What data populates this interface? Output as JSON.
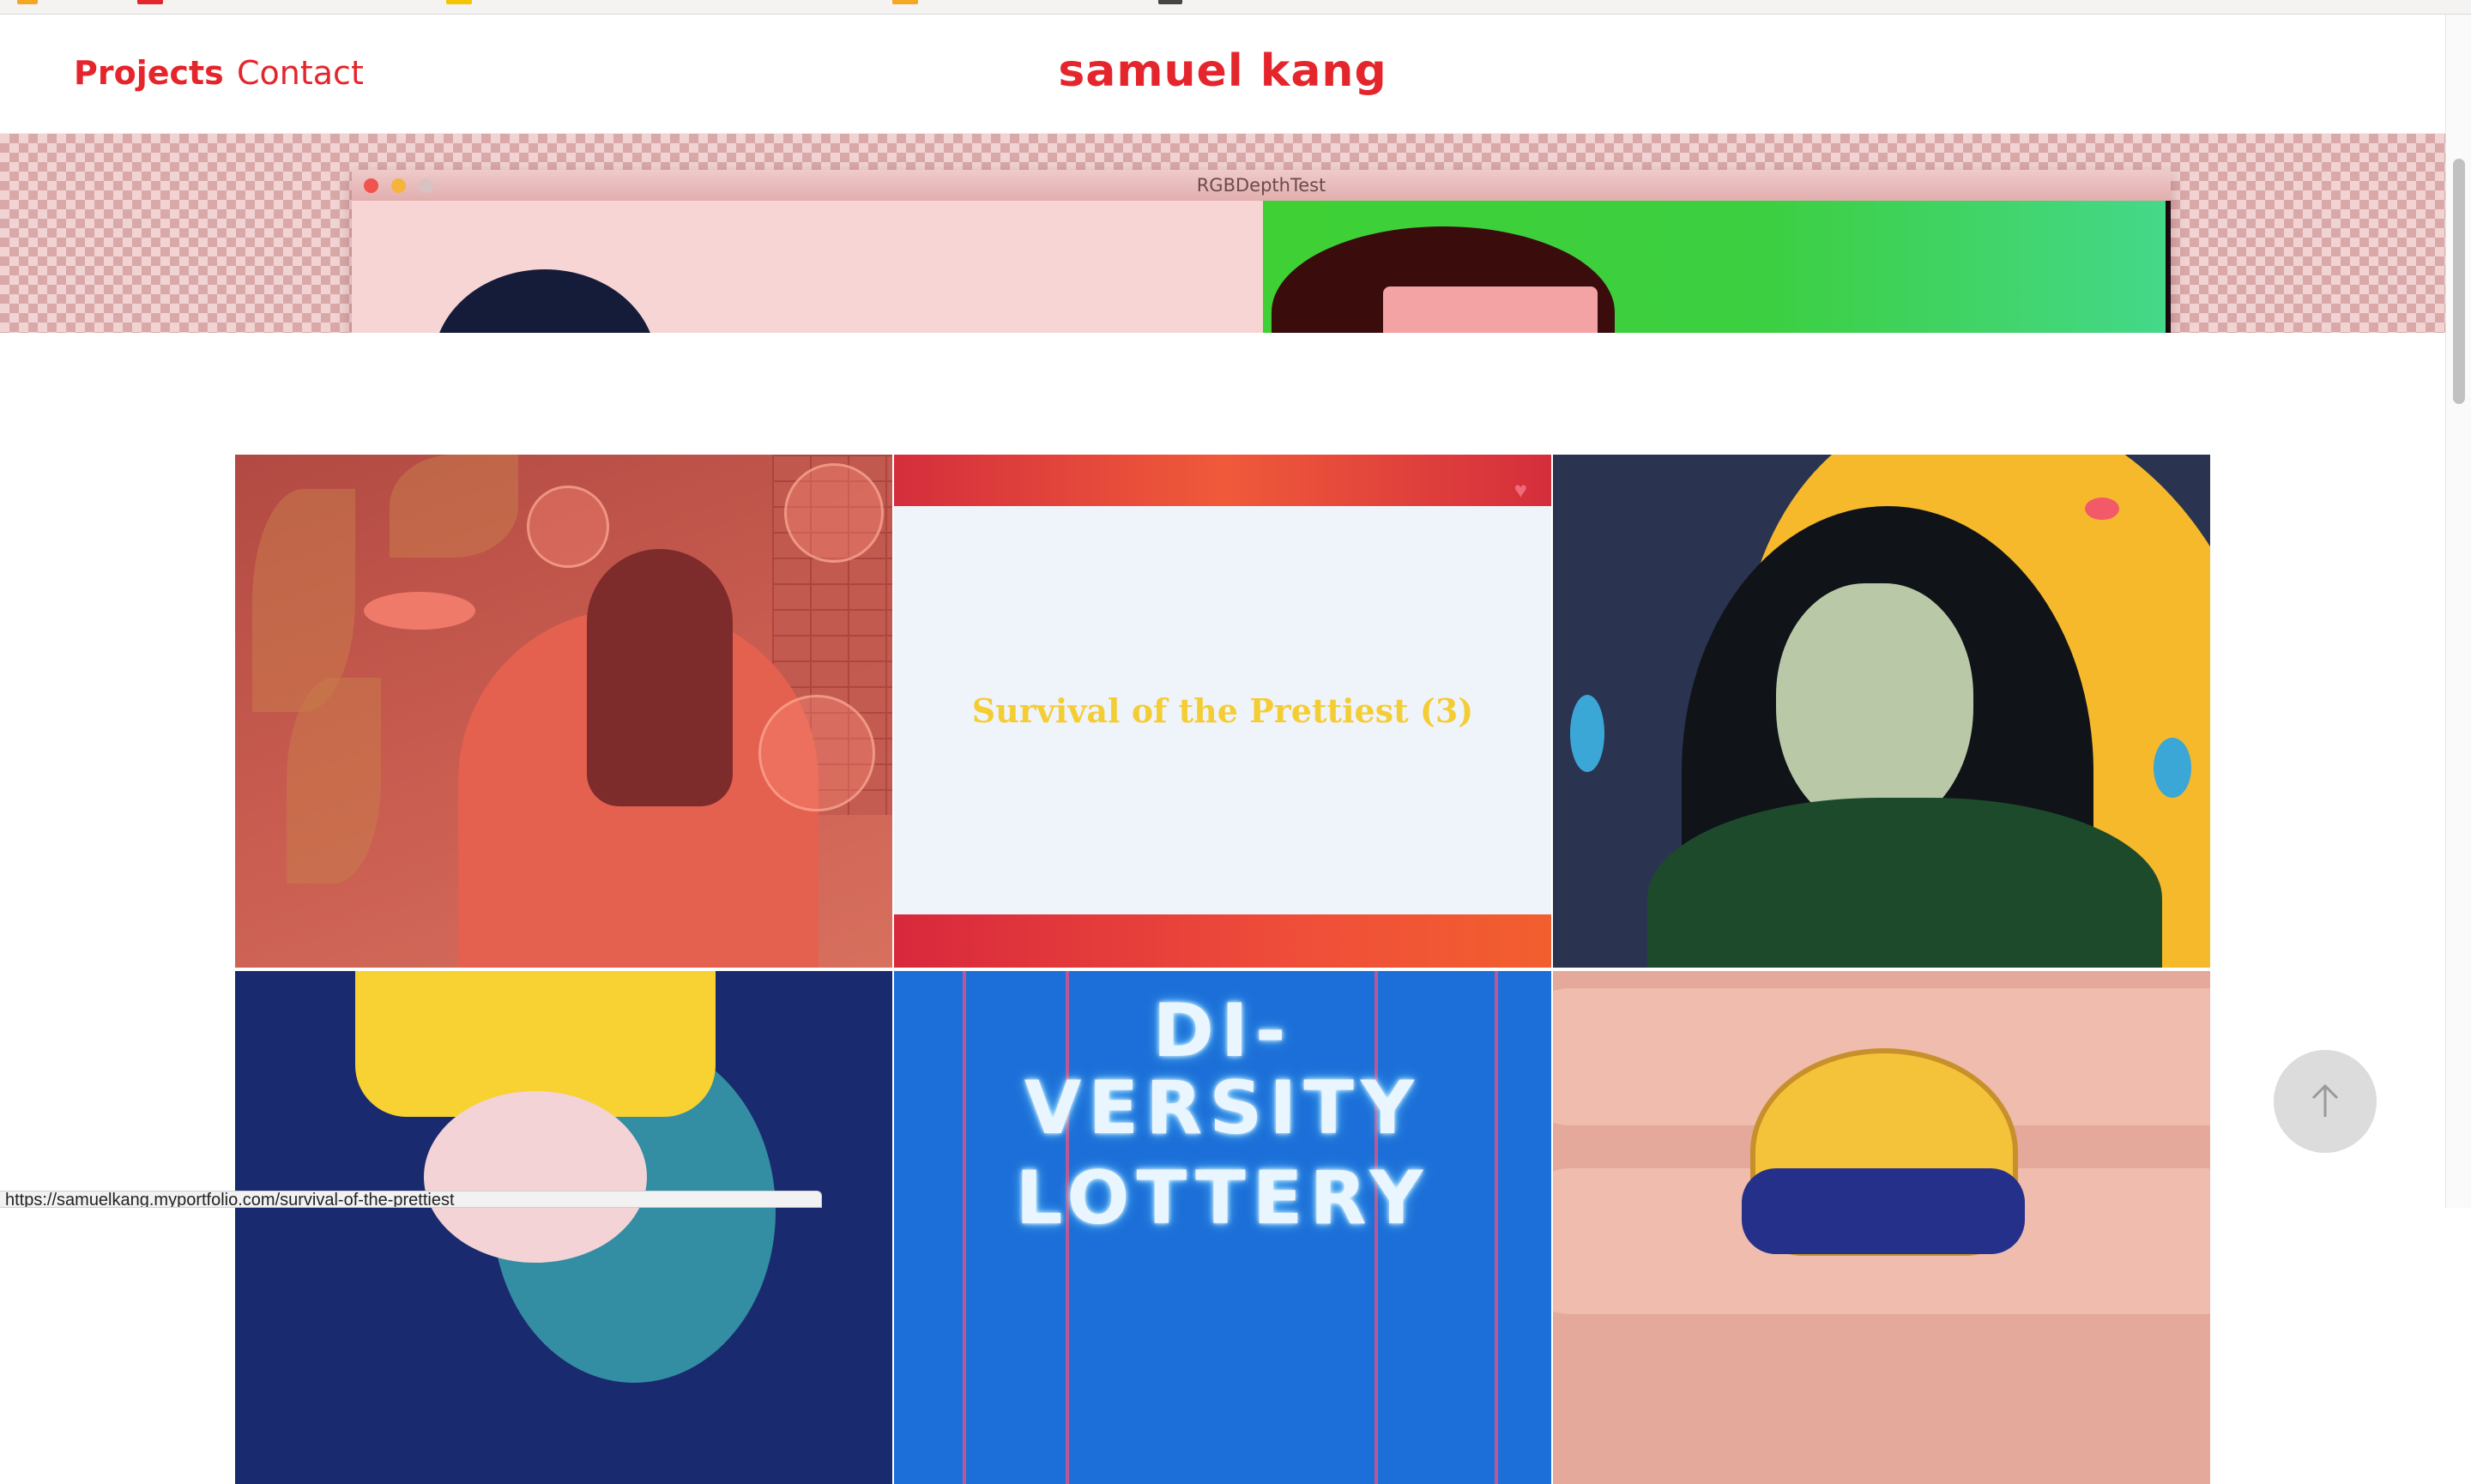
{
  "header": {
    "site_title": "samuel kang",
    "nav": [
      {
        "label": "Projects",
        "active": true
      },
      {
        "label": "Contact",
        "active": false
      }
    ]
  },
  "hero": {
    "window_title": "RGBDepthTest"
  },
  "projects": [
    {
      "id": "tile-1",
      "caption": ""
    },
    {
      "id": "tile-2",
      "caption": "Survival of the Prettiest (3)"
    },
    {
      "id": "tile-3",
      "caption": ""
    },
    {
      "id": "tile-4",
      "caption": ""
    },
    {
      "id": "tile-5",
      "caption": "",
      "artwork_text_line1": "DI-",
      "artwork_text_line2": "VERSITY",
      "artwork_text_line3": "LOTTERY"
    },
    {
      "id": "tile-6",
      "caption": ""
    }
  ],
  "scroll_top": {
    "icon": "arrow-up-icon"
  },
  "status_bar": {
    "url": "https://samuelkang.myportfolio.com/survival-of-the-prettiest"
  },
  "colors": {
    "brand": "#e4262c",
    "caption": "#f4cd35",
    "hover_panel": "#eff4fb"
  }
}
